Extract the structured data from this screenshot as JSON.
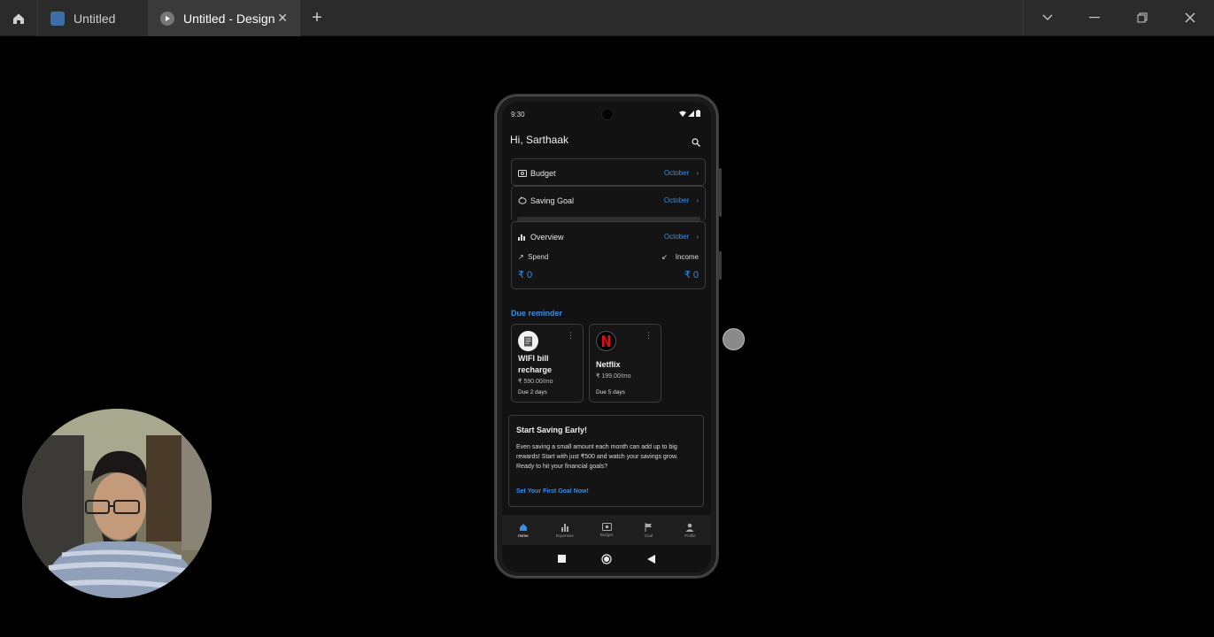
{
  "window": {
    "tabs": [
      {
        "label": "Untitled",
        "active": false
      },
      {
        "label": "Untitled - Design",
        "active": true
      }
    ],
    "icons": {
      "home": "home-icon",
      "close_tab": "close-icon",
      "new_tab": "plus-icon",
      "dropdown": "chevron-down-icon",
      "minimize": "minimize-icon",
      "restore": "restore-icon",
      "close": "close-icon"
    }
  },
  "phone": {
    "status": {
      "time": "9:30"
    },
    "greeting": "Hi, Sarthaak",
    "cards": {
      "budget": {
        "label": "Budget",
        "month": "October"
      },
      "saving_goal": {
        "label": "Saving Goal",
        "month": "October"
      },
      "overview": {
        "label": "Overview",
        "month": "October",
        "spend_label": "Spend",
        "income_label": "Income",
        "spend_amount": "₹ 0",
        "income_amount": "₹ 0"
      }
    },
    "due_reminder": {
      "title": "Due reminder",
      "items": [
        {
          "name": "WIFI bill recharge",
          "price": "₹ 590.00/mo",
          "due": "Due 2 days"
        },
        {
          "name": "Netflix",
          "price": "₹ 199.00/mo",
          "due": "Due 5 days"
        }
      ]
    },
    "promo": {
      "title": "Start Saving Early!",
      "body": "Even saving a small amount each month can add up to big rewards! Start with just ₹500 and watch your savings grow. Ready to hit your financial goals?",
      "cta": "Set Your First Goal Now!"
    },
    "bottom_nav": [
      {
        "label": "Home",
        "icon": "home-icon",
        "active": true
      },
      {
        "label": "Expenses",
        "icon": "bar-chart-icon",
        "active": false
      },
      {
        "label": "Budget",
        "icon": "wallet-icon",
        "active": false
      },
      {
        "label": "Goal",
        "icon": "flag-icon",
        "active": false
      },
      {
        "label": "Profile",
        "icon": "person-icon",
        "active": false
      }
    ]
  },
  "colors": {
    "accent": "#3a8ee6",
    "netflix": "#e50914"
  }
}
